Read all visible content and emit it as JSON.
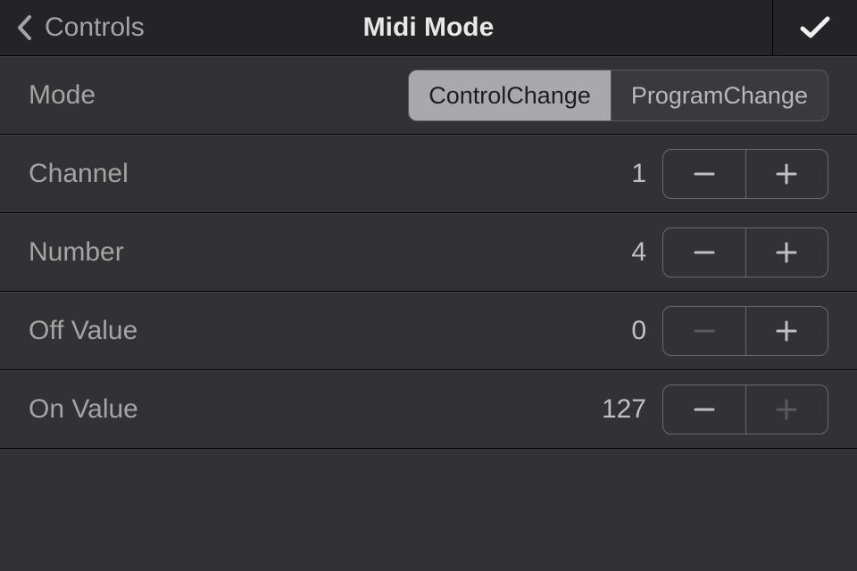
{
  "header": {
    "back_label": "Controls",
    "title": "Midi Mode"
  },
  "rows": {
    "mode": {
      "label": "Mode",
      "options": [
        "ControlChange",
        "ProgramChange"
      ],
      "selected": 0
    },
    "channel": {
      "label": "Channel",
      "value": "1",
      "minus_disabled": false,
      "plus_disabled": false
    },
    "number": {
      "label": "Number",
      "value": "4",
      "minus_disabled": false,
      "plus_disabled": false
    },
    "off_value": {
      "label": "Off Value",
      "value": "0",
      "minus_disabled": true,
      "plus_disabled": false
    },
    "on_value": {
      "label": "On Value",
      "value": "127",
      "minus_disabled": false,
      "plus_disabled": true
    }
  }
}
